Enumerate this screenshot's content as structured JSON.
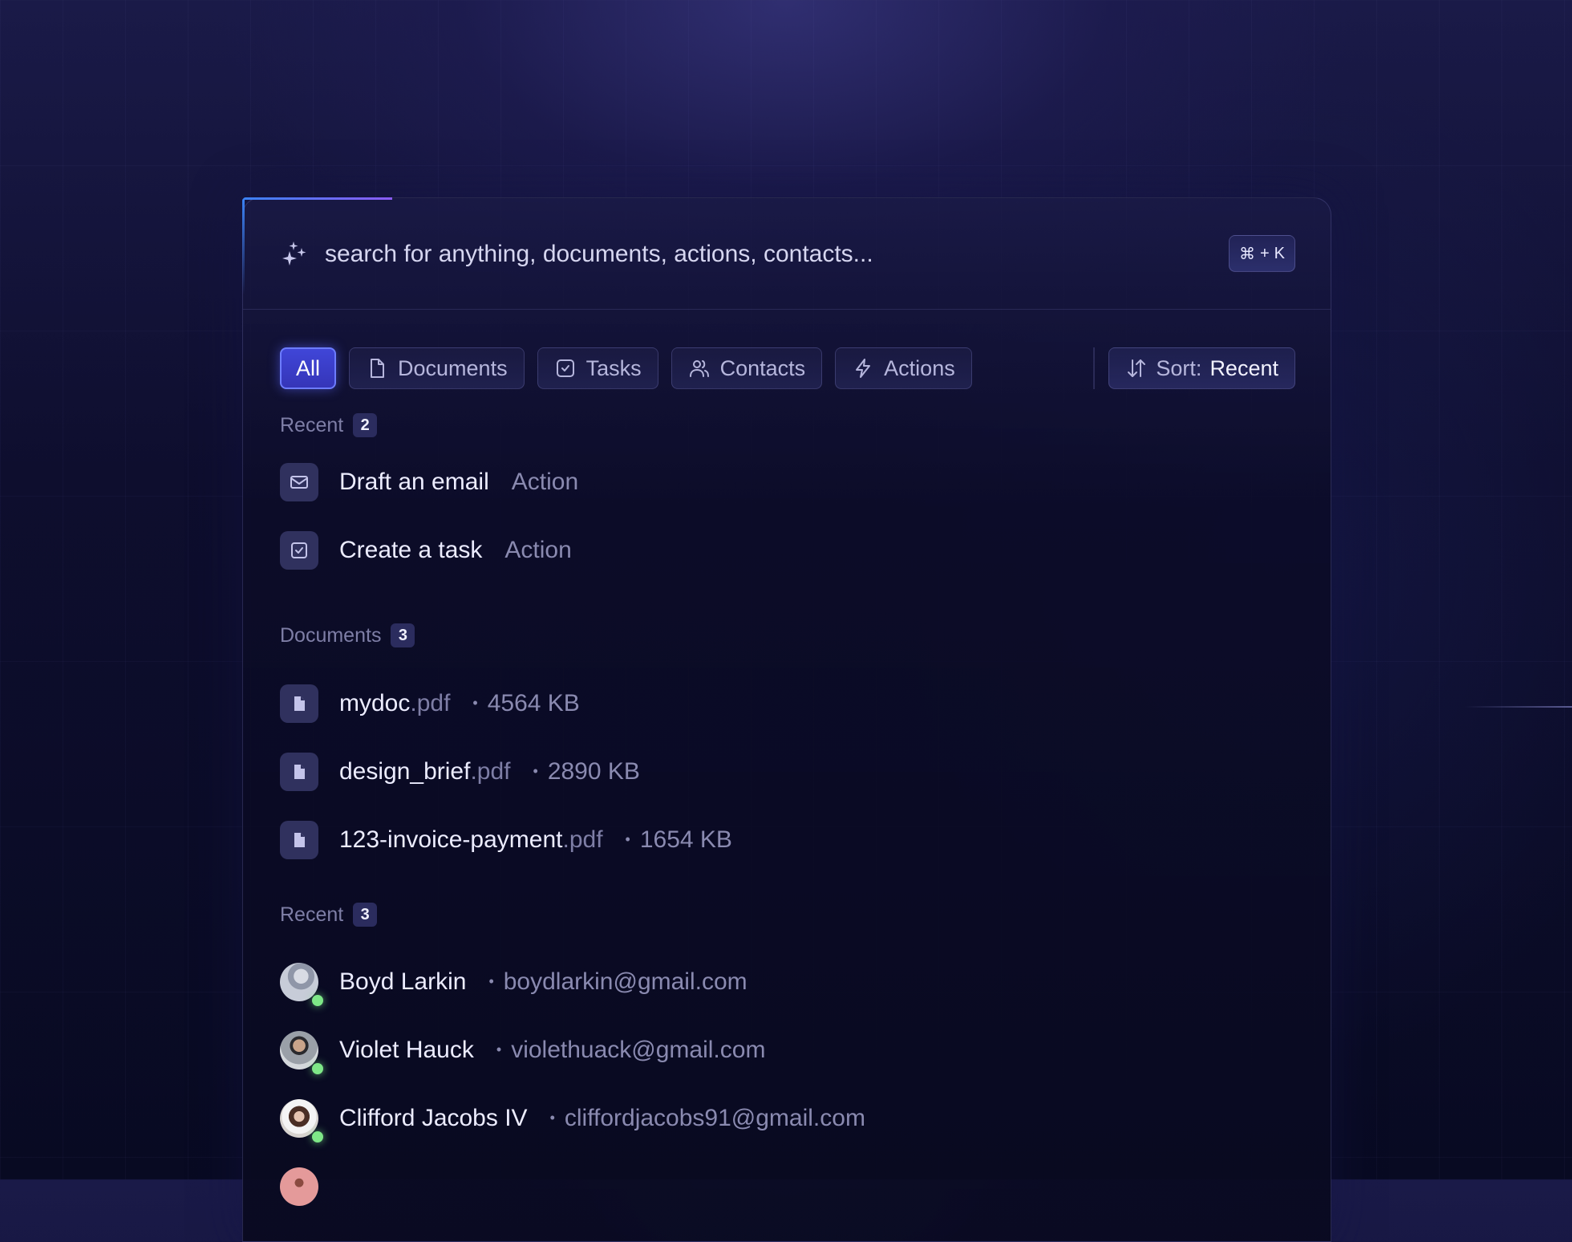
{
  "search": {
    "placeholder": "search for anything, documents, actions, contacts...",
    "shortcut_symbol": "⌘",
    "shortcut_plus": "+",
    "shortcut_key": "K",
    "icon": "sparkles-icon"
  },
  "filters": [
    {
      "label": "All",
      "icon": null,
      "active": true
    },
    {
      "label": "Documents",
      "icon": "file-icon",
      "active": false
    },
    {
      "label": "Tasks",
      "icon": "checkbox-icon",
      "active": false
    },
    {
      "label": "Contacts",
      "icon": "users-icon",
      "active": false
    },
    {
      "label": "Actions",
      "icon": "lightning-icon",
      "active": false
    }
  ],
  "sort": {
    "label": "Sort:",
    "value": "Recent",
    "icon": "sort-arrows-icon"
  },
  "sections": {
    "recent_actions": {
      "title": "Recent",
      "count": "2",
      "items": [
        {
          "title": "Draft an email",
          "type": "Action",
          "icon": "mail-icon"
        },
        {
          "title": "Create a task",
          "type": "Action",
          "icon": "checkbox-icon"
        }
      ]
    },
    "documents": {
      "title": "Documents",
      "count": "3",
      "items": [
        {
          "name": "mydoc",
          "ext": ".pdf",
          "size": "4564 KB",
          "icon": "file-icon"
        },
        {
          "name": "design_brief",
          "ext": ".pdf",
          "size": "2890 KB",
          "icon": "file-icon"
        },
        {
          "name": "123-invoice-payment",
          "ext": ".pdf",
          "size": "1654 KB",
          "icon": "file-icon"
        }
      ]
    },
    "recent_contacts": {
      "title": "Recent",
      "count": "3",
      "items": [
        {
          "name": "Boyd Larkin",
          "email": "boydlarkin@gmail.com",
          "status": "online"
        },
        {
          "name": "Violet Hauck",
          "email": "violethuack@gmail.com",
          "status": "online"
        },
        {
          "name": "Clifford Jacobs IV",
          "email": "cliffordjacobs91@gmail.com",
          "status": "online"
        }
      ]
    }
  },
  "colors": {
    "accent": "#4046d8",
    "accent_border": "#6d7cff",
    "status_online": "#7ee787",
    "gradient_start": "#3b82f6",
    "gradient_end": "#8b5cf6"
  }
}
